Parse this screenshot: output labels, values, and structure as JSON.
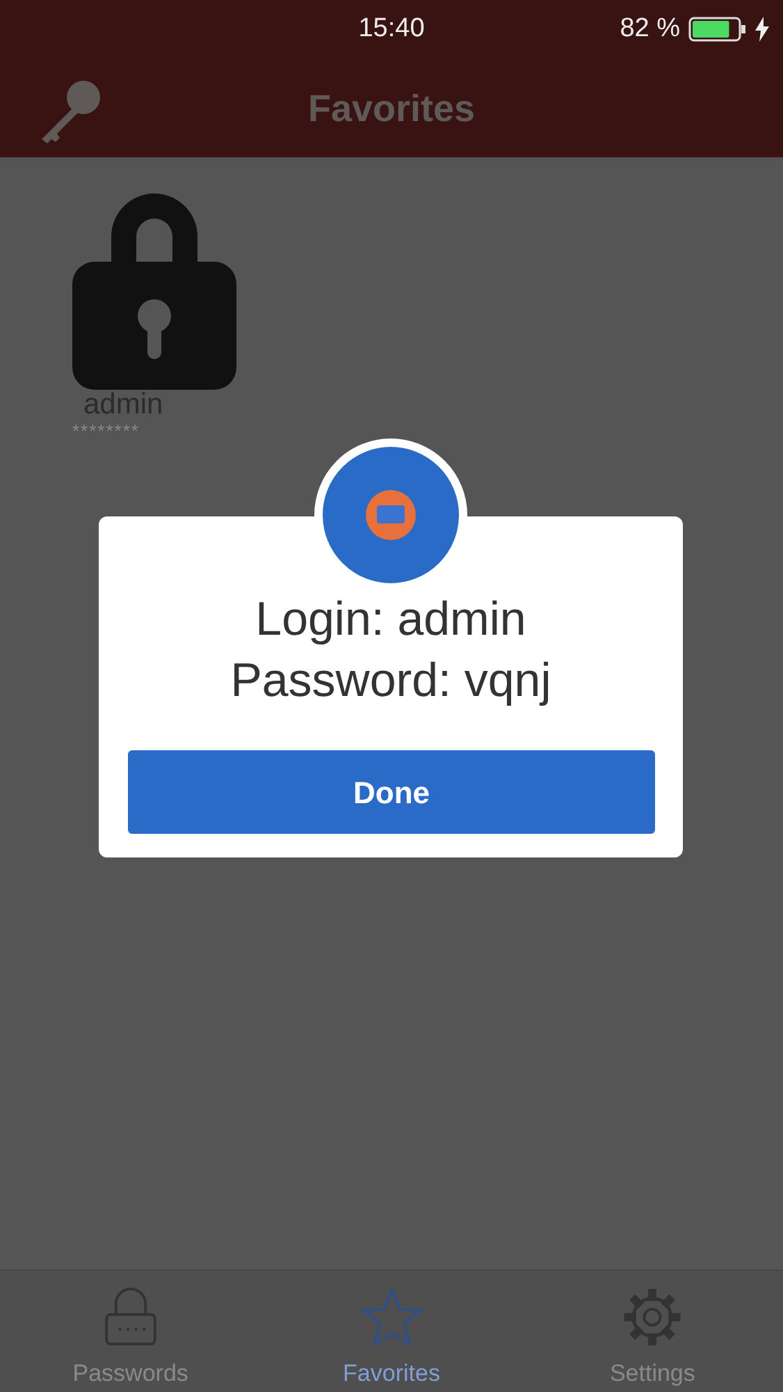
{
  "status_bar": {
    "time": "15:40",
    "battery_text": "82 %",
    "charging": true
  },
  "nav_bar": {
    "title": "Favorites"
  },
  "favorites": [
    {
      "login": "admin",
      "password_mask": "********"
    }
  ],
  "dialog": {
    "lines": [
      "Login: admin",
      "Password: vqnj"
    ],
    "button": "Done"
  },
  "tabs": [
    {
      "label": "Passwords",
      "kind": "lock",
      "selected": false
    },
    {
      "label": "Favorites",
      "kind": "star",
      "selected": true
    },
    {
      "label": "Settings",
      "kind": "gear",
      "selected": false
    }
  ]
}
